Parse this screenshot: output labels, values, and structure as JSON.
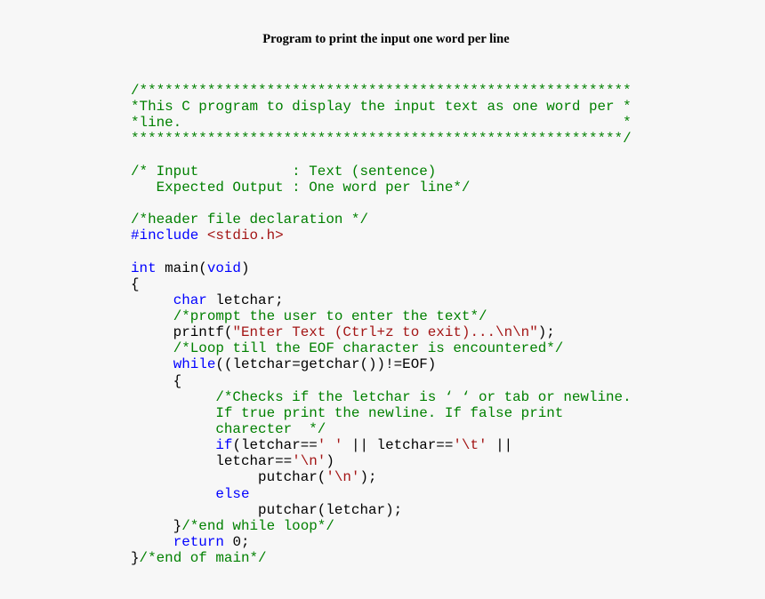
{
  "document": {
    "title": "Program to print the input one word per line",
    "language": "C",
    "colors": {
      "background": "#f7f7f7",
      "comment": "#008000",
      "keyword": "#0000ff",
      "string": "#a31515",
      "plain": "#000000"
    },
    "code_lines": [
      [
        {
          "t": "c",
          "v": "/**********************************************************"
        }
      ],
      [
        {
          "t": "c",
          "v": "*This C program to display the input text as one word per *"
        }
      ],
      [
        {
          "t": "c",
          "v": "*line.                                                    *"
        }
      ],
      [
        {
          "t": "c",
          "v": "**********************************************************/"
        }
      ],
      [],
      [
        {
          "t": "c",
          "v": "/* Input           : Text (sentence)"
        }
      ],
      [
        {
          "t": "c",
          "v": "   Expected Output : One word per line*/"
        }
      ],
      [],
      [
        {
          "t": "c",
          "v": "/*header file declaration */"
        }
      ],
      [
        {
          "t": "k",
          "v": "#include "
        },
        {
          "t": "s",
          "v": "<stdio.h>"
        }
      ],
      [],
      [
        {
          "t": "k",
          "v": "int"
        },
        {
          "t": "p",
          "v": " main("
        },
        {
          "t": "k",
          "v": "void"
        },
        {
          "t": "p",
          "v": ")"
        }
      ],
      [
        {
          "t": "p",
          "v": "{"
        }
      ],
      [
        {
          "t": "p",
          "v": "     "
        },
        {
          "t": "k",
          "v": "char"
        },
        {
          "t": "p",
          "v": " letchar;"
        }
      ],
      [
        {
          "t": "p",
          "v": "     "
        },
        {
          "t": "c",
          "v": "/*prompt the user to enter the text*/"
        }
      ],
      [
        {
          "t": "p",
          "v": "     printf("
        },
        {
          "t": "s",
          "v": "\"Enter Text (Ctrl+z to exit)...\\n\\n\""
        },
        {
          "t": "p",
          "v": ");"
        }
      ],
      [
        {
          "t": "p",
          "v": "     "
        },
        {
          "t": "c",
          "v": "/*Loop till the EOF character is encountered*/"
        }
      ],
      [
        {
          "t": "p",
          "v": "     "
        },
        {
          "t": "k",
          "v": "while"
        },
        {
          "t": "p",
          "v": "((letchar=getchar())!=EOF)"
        }
      ],
      [
        {
          "t": "p",
          "v": "     {"
        }
      ],
      [
        {
          "t": "p",
          "v": "          "
        },
        {
          "t": "c",
          "v": "/*Checks if the letchar is ‘ ‘ or tab or newline."
        }
      ],
      [
        {
          "t": "c",
          "v": "          If true print the newline. If false print"
        }
      ],
      [
        {
          "t": "c",
          "v": "          charecter  */"
        }
      ],
      [
        {
          "t": "p",
          "v": "          "
        },
        {
          "t": "k",
          "v": "if"
        },
        {
          "t": "p",
          "v": "(letchar=="
        },
        {
          "t": "s",
          "v": "' '"
        },
        {
          "t": "p",
          "v": " || letchar=="
        },
        {
          "t": "s",
          "v": "'\\t'"
        },
        {
          "t": "p",
          "v": " ||"
        }
      ],
      [
        {
          "t": "p",
          "v": "          letchar=="
        },
        {
          "t": "s",
          "v": "'\\n'"
        },
        {
          "t": "p",
          "v": ")"
        }
      ],
      [
        {
          "t": "p",
          "v": "               putchar("
        },
        {
          "t": "s",
          "v": "'\\n'"
        },
        {
          "t": "p",
          "v": ");"
        }
      ],
      [
        {
          "t": "p",
          "v": "          "
        },
        {
          "t": "k",
          "v": "else"
        }
      ],
      [
        {
          "t": "p",
          "v": "               putchar(letchar);"
        }
      ],
      [
        {
          "t": "p",
          "v": "     }"
        },
        {
          "t": "c",
          "v": "/*end while loop*/"
        }
      ],
      [
        {
          "t": "p",
          "v": "     "
        },
        {
          "t": "k",
          "v": "return"
        },
        {
          "t": "p",
          "v": " 0;"
        }
      ],
      [
        {
          "t": "p",
          "v": "}"
        },
        {
          "t": "c",
          "v": "/*end of main*/"
        }
      ]
    ]
  }
}
